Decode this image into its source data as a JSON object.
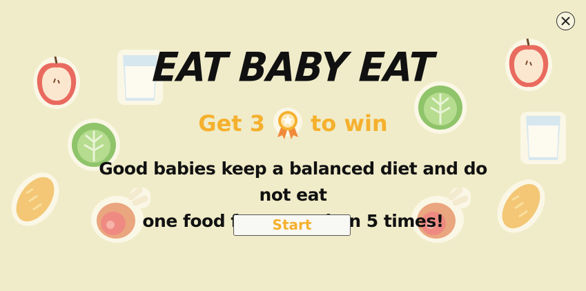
{
  "game": {
    "title": "EAT BABY EAT",
    "goal": {
      "prefix": "Get 3",
      "icon": "award-badge-icon",
      "suffix": "to win"
    },
    "description_line1": "Good babies keep a balanced diet and do not eat",
    "description_line2": "one food for more than 5 times!",
    "start_label": "Start",
    "close_icon": "close-icon"
  },
  "colors": {
    "background": "#f0ecc9",
    "accent": "#f5b02e",
    "text": "#111111"
  },
  "decorations": [
    "apple-icon",
    "milk-glass-icon",
    "cabbage-icon",
    "bread-icon",
    "ham-leg-icon",
    "cabbage-icon",
    "apple-icon",
    "milk-glass-icon",
    "bread-icon",
    "ham-leg-icon"
  ]
}
